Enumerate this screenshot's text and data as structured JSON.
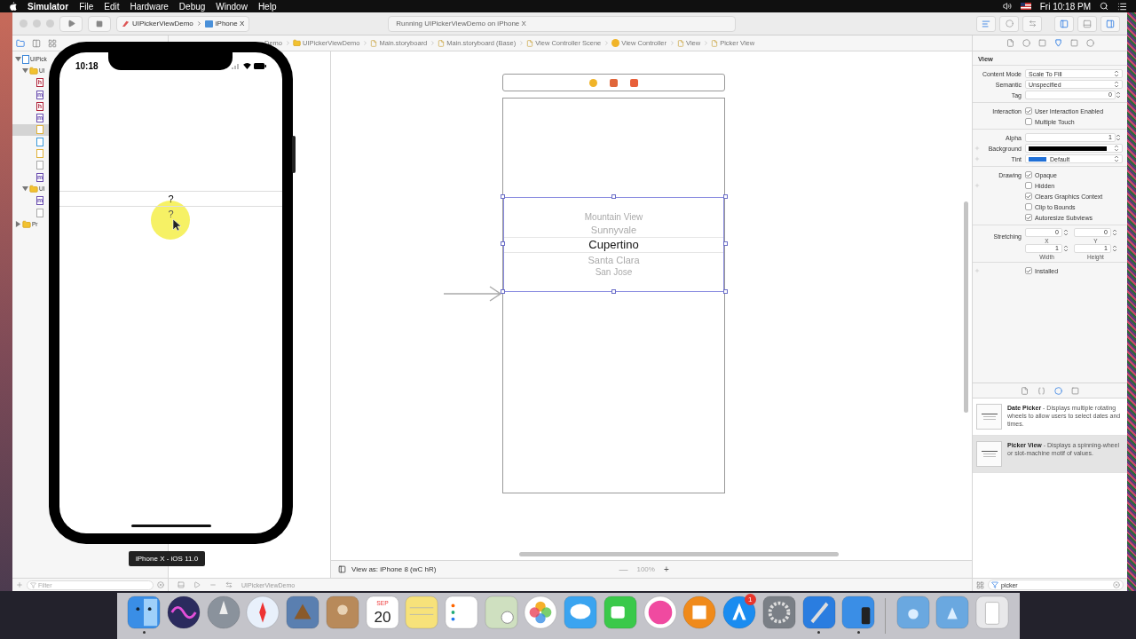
{
  "menubar": {
    "app": "Simulator",
    "menus": [
      "File",
      "Edit",
      "Hardware",
      "Debug",
      "Window",
      "Help"
    ],
    "clock": "Fri 10:18 PM"
  },
  "toolbar": {
    "scheme": "UIPickerViewDemo",
    "device": "iPhone X",
    "status": "Running UIPickerViewDemo on iPhone X"
  },
  "navigator": {
    "tree": [
      {
        "label": "UIPick",
        "kind": "project",
        "expanded": true,
        "selected": false,
        "children": [
          {
            "label": "UI",
            "kind": "folder",
            "expanded": true,
            "selected": false,
            "children": [
              {
                "kind": "source",
                "glyph": "h",
                "selected": false
              },
              {
                "kind": "source",
                "glyph": "m",
                "selected": false
              },
              {
                "kind": "source",
                "glyph": "h",
                "selected": false
              },
              {
                "kind": "source",
                "glyph": "m",
                "selected": false
              },
              {
                "kind": "storyboard",
                "selected": true
              },
              {
                "kind": "assets",
                "selected": false
              },
              {
                "kind": "storyboard",
                "selected": false
              },
              {
                "kind": "plist",
                "selected": false
              },
              {
                "kind": "source",
                "glyph": "m",
                "selected": false
              }
            ]
          },
          {
            "label": "UI",
            "kind": "folder",
            "expanded": true,
            "selected": false,
            "children": [
              {
                "kind": "source",
                "glyph": "m",
                "selected": false
              },
              {
                "kind": "plist",
                "selected": false
              }
            ]
          }
        ]
      },
      {
        "label": "Pr",
        "kind": "folder",
        "expanded": false,
        "selected": false
      }
    ],
    "filter": {
      "placeholder": "Filter"
    }
  },
  "jumpbar": [
    "Demo",
    "UIPickerViewDemo",
    "Main.storyboard",
    "Main.storyboard (Base)",
    "View Controller Scene",
    "View Controller",
    "View",
    "Picker View"
  ],
  "simulator": {
    "time": "10:18",
    "picker": [
      {
        "label": "?",
        "selected": true
      },
      {
        "label": "?",
        "selected": false
      }
    ],
    "tooltip": "iPhone X - iOS 11.0"
  },
  "canvas": {
    "picker": [
      {
        "label": "Mountain View",
        "selected": false
      },
      {
        "label": "Sunnyvale",
        "selected": false
      },
      {
        "label": "Cupertino",
        "selected": true
      },
      {
        "label": "Santa Clara",
        "selected": false
      },
      {
        "label": "San Jose",
        "selected": false
      }
    ],
    "view_as": "View as: iPhone 8 (wC hR)",
    "zoom_out": "—",
    "zoom": "100%",
    "zoom_in": "+"
  },
  "debug_bar": {
    "target": "UIPickerViewDemo"
  },
  "inspector": {
    "section": "View",
    "groups": [
      {
        "rows": [
          {
            "kind": "select",
            "label": "Content Mode",
            "value": "Scale To Fill"
          },
          {
            "kind": "select",
            "label": "Semantic",
            "value": "Unspecified"
          },
          {
            "kind": "stepper",
            "label": "Tag",
            "value": "0"
          }
        ]
      },
      {
        "rows": [
          {
            "kind": "check",
            "label": "Interaction",
            "text": "User Interaction Enabled",
            "checked": true
          },
          {
            "kind": "check",
            "text": "Multiple Touch",
            "checked": false
          }
        ]
      },
      {
        "rows": [
          {
            "kind": "stepper",
            "label": "Alpha",
            "value": "1"
          },
          {
            "kind": "color",
            "label": "Background",
            "color": "#000000",
            "plus": true
          },
          {
            "kind": "color",
            "label": "Tint",
            "color": "#1f6fd6",
            "value": "Default",
            "plus": true
          }
        ]
      },
      {
        "rows": [
          {
            "kind": "check",
            "label": "Drawing",
            "text": "Opaque",
            "checked": true
          },
          {
            "kind": "check",
            "text": "Hidden",
            "checked": false,
            "plus": true
          },
          {
            "kind": "check",
            "text": "Clears Graphics Context",
            "checked": true
          },
          {
            "kind": "check",
            "text": "Clip to Bounds",
            "checked": false
          },
          {
            "kind": "check",
            "text": "Autoresize Subviews",
            "checked": true
          }
        ]
      },
      {
        "rows": [
          {
            "kind": "pair",
            "label": "Stretching",
            "values": [
              {
                "value": "0",
                "caption": "X"
              },
              {
                "value": "0",
                "caption": "Y"
              }
            ]
          },
          {
            "kind": "pair",
            "values": [
              {
                "value": "1",
                "caption": "Width"
              },
              {
                "value": "1",
                "caption": "Height"
              }
            ]
          }
        ]
      },
      {
        "rows": [
          {
            "kind": "check",
            "text": "Installed",
            "checked": true,
            "plus": true
          }
        ]
      }
    ]
  },
  "library": {
    "items": [
      {
        "name": "Date Picker",
        "description": " - Displays multiple rotating wheels to allow users to select dates and times.",
        "selected": false
      },
      {
        "name": "Picker View",
        "description": " - Displays a spinning-wheel or slot-machine motif of values.",
        "selected": true
      }
    ],
    "search": "picker"
  },
  "dock": [
    {
      "kind": "finder",
      "running": true
    },
    {
      "kind": "siri",
      "running": false
    },
    {
      "kind": "launchpad",
      "running": false
    },
    {
      "kind": "safari",
      "running": false
    },
    {
      "kind": "stamp",
      "running": false
    },
    {
      "kind": "contacts",
      "running": false
    },
    {
      "kind": "calendar",
      "month": "SEP",
      "day": "20",
      "running": false
    },
    {
      "kind": "notes",
      "running": false
    },
    {
      "kind": "reminders",
      "running": false
    },
    {
      "kind": "preview",
      "running": false
    },
    {
      "kind": "photos",
      "running": false
    },
    {
      "kind": "messages",
      "running": false
    },
    {
      "kind": "facetime",
      "running": false
    },
    {
      "kind": "music",
      "running": false
    },
    {
      "kind": "books",
      "running": false
    },
    {
      "kind": "appstore",
      "badge": "1",
      "running": false
    },
    {
      "kind": "settings",
      "running": false
    },
    {
      "kind": "xcode",
      "running": true
    },
    {
      "kind": "simulator",
      "running": true
    },
    {
      "kind": "separator"
    },
    {
      "kind": "downloads",
      "running": false
    },
    {
      "kind": "applications",
      "running": false
    },
    {
      "kind": "trash",
      "running": false
    }
  ]
}
